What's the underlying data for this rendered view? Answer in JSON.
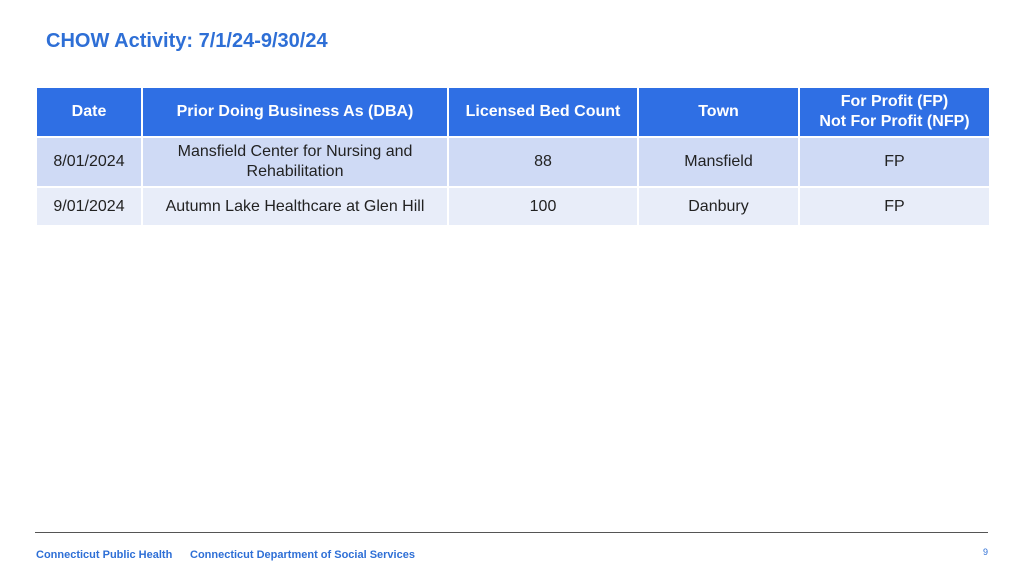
{
  "slide": {
    "title": "CHOW Activity: 7/1/24-9/30/24"
  },
  "table": {
    "headers": {
      "date": "Date",
      "dba": "Prior Doing Business As (DBA)",
      "beds": "Licensed Bed Count",
      "town": "Town",
      "profit_line1": "For Profit (FP)",
      "profit_line2": "Not For Profit (NFP)"
    },
    "rows": [
      {
        "date": "8/01/2024",
        "dba": "Mansfield Center for Nursing and Rehabilitation",
        "beds": "88",
        "town": "Mansfield",
        "profit": "FP"
      },
      {
        "date": "9/01/2024",
        "dba": "Autumn Lake Healthcare at Glen Hill",
        "beds": "100",
        "town": "Danbury",
        "profit": "FP"
      }
    ]
  },
  "footer": {
    "org1": "Connecticut Public Health",
    "org2": "Connecticut Department of Social Services",
    "page_number": "9"
  },
  "colors": {
    "title": "#2e6fd6",
    "header_bg": "#2f6fe4",
    "row_odd_bg": "#cfdaf5",
    "row_even_bg": "#e8edf9"
  }
}
